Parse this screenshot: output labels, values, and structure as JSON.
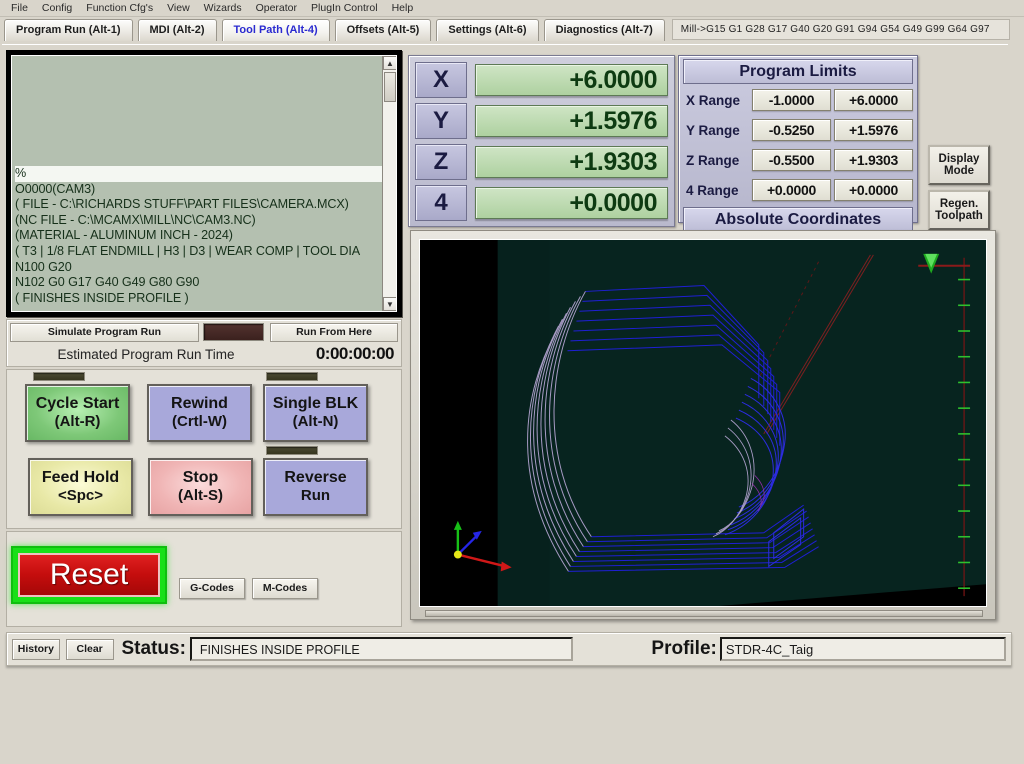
{
  "menubar": {
    "items": [
      {
        "label": "File"
      },
      {
        "label": "Config"
      },
      {
        "label": "Function Cfg's"
      },
      {
        "label": "View"
      },
      {
        "label": "Wizards"
      },
      {
        "label": "Operator"
      },
      {
        "label": "PlugIn Control"
      },
      {
        "label": "Help"
      }
    ]
  },
  "tabs": [
    {
      "label": "Program Run (Alt-1)",
      "active": false
    },
    {
      "label": "MDI (Alt-2)",
      "active": false
    },
    {
      "label": "Tool Path (Alt-4)",
      "active": true
    },
    {
      "label": "Offsets (Alt-5)",
      "active": false
    },
    {
      "label": "Settings (Alt-6)",
      "active": false
    },
    {
      "label": "Diagnostics (Alt-7)",
      "active": false
    }
  ],
  "gcode_status_line": "Mill->G15   G1 G28 G17 G40 G20 G91 G94 G54 G49 G99 G64 G97",
  "gcode_editor": {
    "lines": [
      "%",
      "O0000(CAM3)",
      "( FILE - C:\\RICHARDS STUFF\\PART FILES\\CAMERA.MCX)",
      "(NC FILE - C:\\MCAMX\\MILL\\NC\\CAM3.NC)",
      "(MATERIAL - ALUMINUM INCH - 2024)",
      "( T3 |  1/8 FLAT ENDMILL | H3 | D3 | WEAR COMP | TOOL DIA",
      "N100 G20",
      "N102 G0 G17 G40 G49 G80 G90",
      "( FINISHES INSIDE PROFILE )"
    ],
    "highlighted_index": 0
  },
  "dro": {
    "axes": [
      {
        "label": "X",
        "value": "+6.0000"
      },
      {
        "label": "Y",
        "value": "+1.5976"
      },
      {
        "label": "Z",
        "value": "+1.9303"
      },
      {
        "label": "4",
        "value": "+0.0000"
      }
    ]
  },
  "program_limits": {
    "title": "Program Limits",
    "footer": "Absolute Coordinates",
    "rows": [
      {
        "label": "X Range",
        "min": "-1.0000",
        "max": "+6.0000"
      },
      {
        "label": "Y Range",
        "min": "-0.5250",
        "max": "+1.5976"
      },
      {
        "label": "Z Range",
        "min": "-0.5500",
        "max": "+1.9303"
      },
      {
        "label": "4 Range",
        "min": "+0.0000",
        "max": "+0.0000"
      }
    ]
  },
  "side_buttons": {
    "display_mode": "Display Mode",
    "regen_toolpath": "Regen. Toolpath"
  },
  "sim_bar": {
    "simulate_label": "Simulate Program Run",
    "run_from_here_label": "Run From Here",
    "runtime_label": "Estimated Program Run Time",
    "runtime_value": "0:00:00:00"
  },
  "controls": [
    {
      "name": "cycle-start",
      "line1": "Cycle Start",
      "line2": "(Alt-R)",
      "color": "green",
      "led": true
    },
    {
      "name": "rewind",
      "line1": "Rewind",
      "line2": "(Crtl-W)",
      "color": "blue",
      "led": false
    },
    {
      "name": "single-blk",
      "line1": "Single BLK",
      "line2": "(Alt-N)",
      "color": "blue",
      "led": true
    },
    {
      "name": "feed-hold",
      "line1": "Feed Hold",
      "line2": "<Spc>",
      "color": "yellow",
      "led": false
    },
    {
      "name": "stop",
      "line1": "Stop",
      "line2": "(Alt-S)",
      "color": "red",
      "led": false
    },
    {
      "name": "reverse-run",
      "line1": "Reverse",
      "line2": "Run",
      "color": "blue",
      "led": true
    }
  ],
  "reset": {
    "label": "Reset",
    "g_codes_label": "G-Codes",
    "m_codes_label": "M-Codes"
  },
  "status_bar": {
    "history_label": "History",
    "clear_label": "Clear",
    "status_label": "Status:",
    "status_value": "FINISHES INSIDE PROFILE",
    "profile_label": "Profile:",
    "profile_value": "STDR-4C_Taig"
  },
  "toolpath": {
    "background_color": "#03201c",
    "rapid_color": "#8b2020",
    "feed_color": "#1a1ad8",
    "arc_color": "#b9b0d8",
    "axis_x_color": "#d01010",
    "axis_y_color": "#10c010",
    "axis_z_color": "#2020e0",
    "origin_color": "#e0e020",
    "ruler_tick_color": "#30c030",
    "tool_marker_color": "#22bb22"
  },
  "colors": {
    "window_bg": "#d9d5cb",
    "dro_value_bg": "#aed1a0",
    "dro_value_text": "#0e3b12",
    "panel_purple": "#b9b9cd",
    "active_tab_text": "#2a2ad0",
    "reset_red": "#c40d0d",
    "reset_halo_green": "#18e018"
  }
}
